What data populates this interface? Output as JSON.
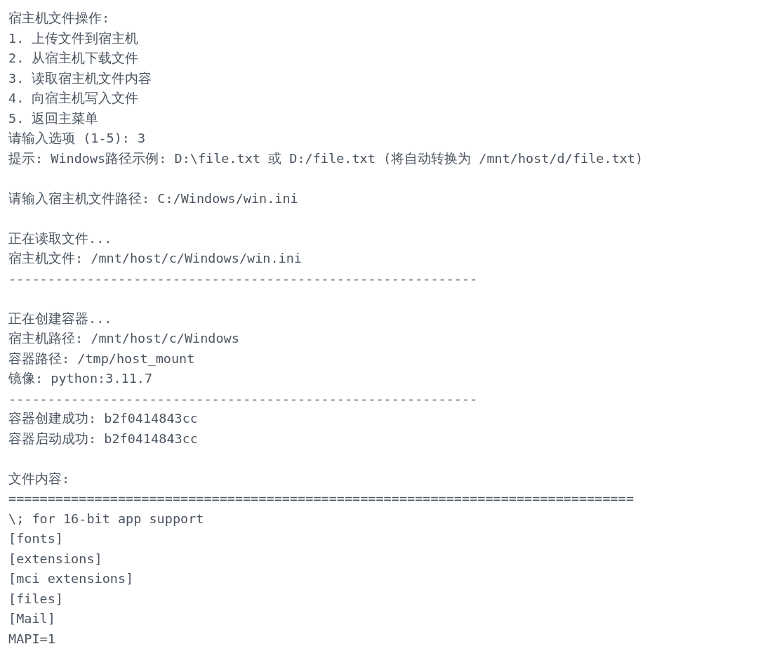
{
  "terminal": {
    "blocks": [
      [
        "宿主机文件操作:",
        "1. 上传文件到宿主机",
        "2. 从宿主机下载文件",
        "3. 读取宿主机文件内容",
        "4. 向宿主机写入文件",
        "5. 返回主菜单",
        "请输入选项 (1-5): 3",
        "提示: Windows路径示例: D:\\file.txt 或 D:/file.txt (将自动转换为 /mnt/host/d/file.txt)"
      ],
      [
        "请输入宿主机文件路径: C:/Windows/win.ini"
      ],
      [
        "正在读取文件...",
        "宿主机文件: /mnt/host/c/Windows/win.ini",
        "------------------------------------------------------------"
      ],
      [
        "正在创建容器...",
        "宿主机路径: /mnt/host/c/Windows",
        "容器路径: /tmp/host_mount",
        "镜像: python:3.11.7",
        "------------------------------------------------------------",
        "容器创建成功: b2f0414843cc",
        "容器启动成功: b2f0414843cc"
      ],
      [
        "文件内容:",
        "================================================================================",
        "\\; for 16-bit app support",
        "[fonts]",
        "[extensions]",
        "[mci extensions]",
        "[files]",
        "[Mail]",
        "MAPI=1"
      ]
    ]
  }
}
